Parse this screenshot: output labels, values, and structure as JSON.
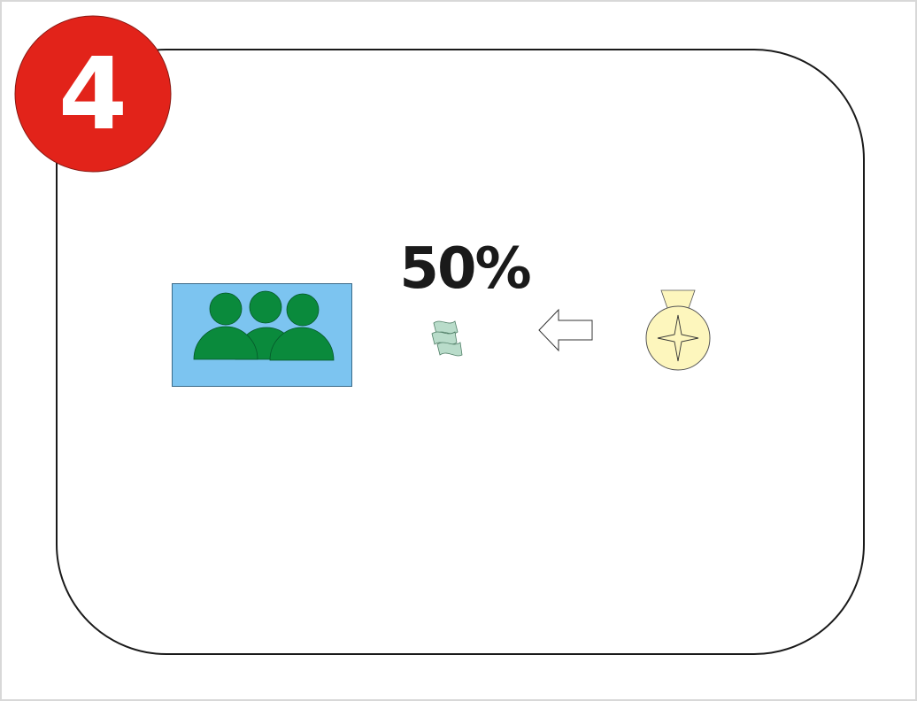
{
  "step": {
    "number": "4",
    "badge_color": "#e2231a"
  },
  "summary": {
    "percentage": "50%"
  },
  "icons": {
    "group": "people-group-icon",
    "money": "money-icon",
    "arrow": "arrow-left-icon",
    "medal": "medal-icon"
  },
  "colors": {
    "group_background": "#7cc4f0",
    "people": "#0a8a3c",
    "money": "#b9dcca",
    "medal": "#fdf6bd"
  }
}
